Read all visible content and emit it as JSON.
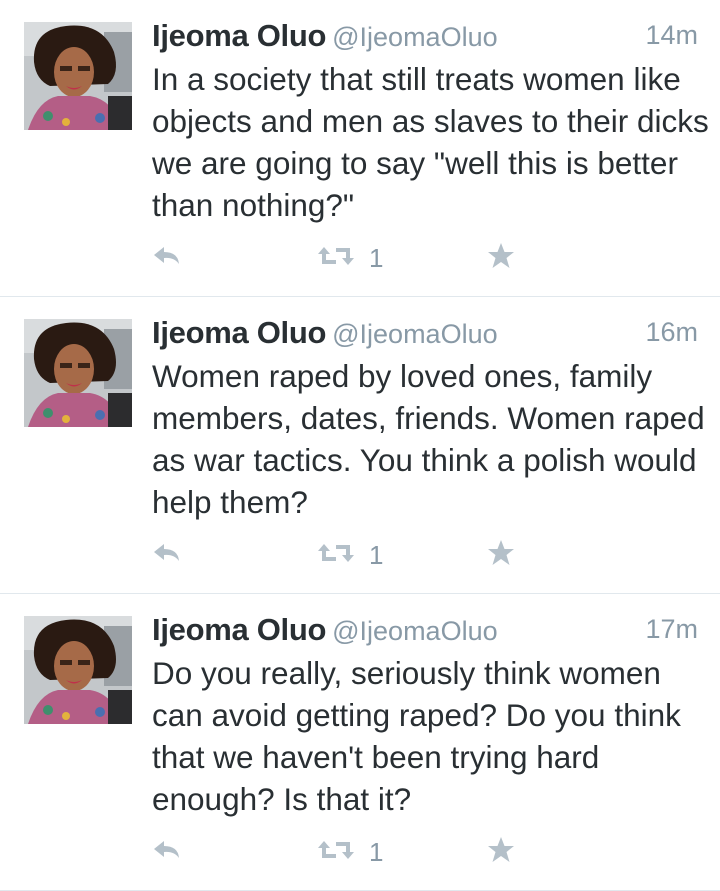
{
  "colors": {
    "text": "#292f33",
    "muted": "#8899a6",
    "icon": "#b4c0c9",
    "divider": "#e1e8ed"
  },
  "tweets": [
    {
      "display_name": "Ijeoma Oluo",
      "handle": "@IjeomaOluo",
      "time": "14m",
      "text": "In a society that still treats women like objects and men as slaves to their dicks we are going to say \"well this is better than nothing?\"",
      "retweets": "1",
      "icons": {
        "reply": "reply-icon",
        "retweet": "retweet-icon",
        "favorite": "star-icon"
      }
    },
    {
      "display_name": "Ijeoma Oluo",
      "handle": "@IjeomaOluo",
      "time": "16m",
      "text": "Women raped by loved ones, family members, dates, friends. Women raped as war tactics. You think a polish would help them?",
      "retweets": "1",
      "icons": {
        "reply": "reply-icon",
        "retweet": "retweet-icon",
        "favorite": "star-icon"
      }
    },
    {
      "display_name": "Ijeoma Oluo",
      "handle": "@IjeomaOluo",
      "time": "17m",
      "text": "Do you really, seriously think women can avoid getting raped? Do you think that we haven't been trying hard enough? Is that it?",
      "retweets": "1",
      "icons": {
        "reply": "reply-icon",
        "retweet": "retweet-icon",
        "favorite": "star-icon"
      }
    }
  ]
}
